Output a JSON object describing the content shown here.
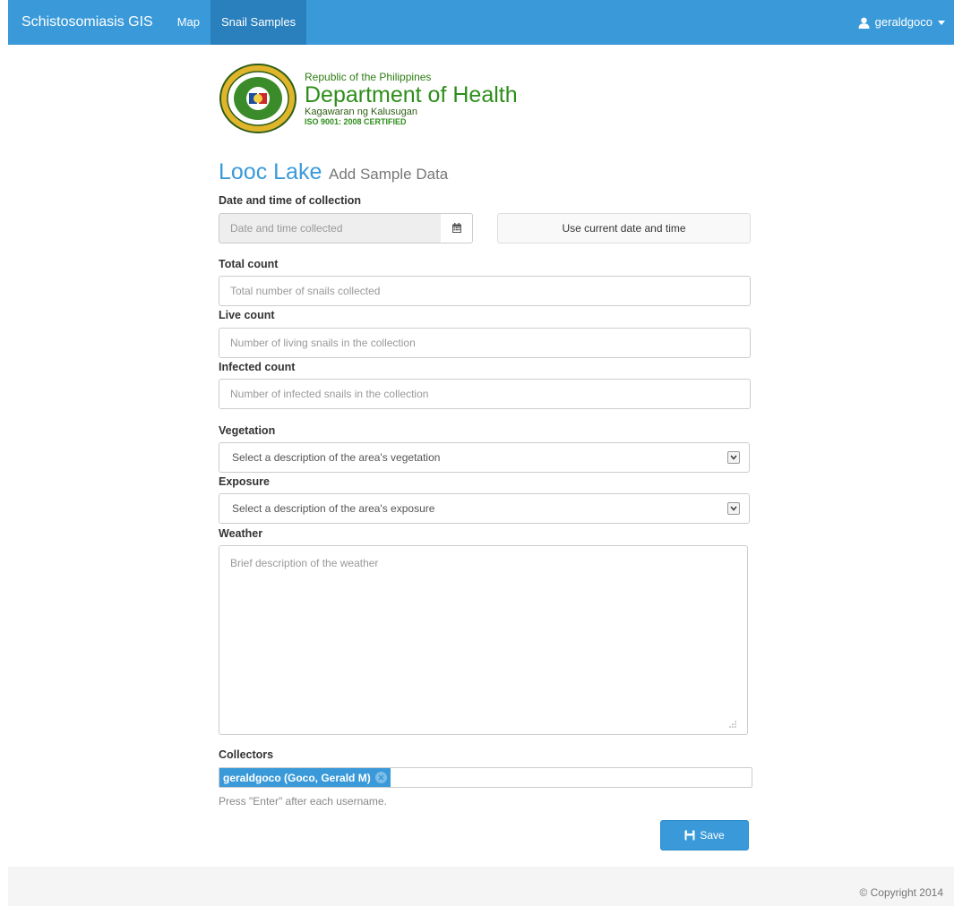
{
  "navbar": {
    "brand": "Schistosomiasis GIS",
    "links": [
      {
        "label": "Map",
        "active": false
      },
      {
        "label": "Snail Samples",
        "active": true
      }
    ],
    "user": "geraldgoco"
  },
  "header": {
    "line1": "Republic of the Philippines",
    "line2": "Department of Health",
    "line3": "Kagawaran ng Kalusugan",
    "line4": "ISO 9001: 2008 CERTIFIED"
  },
  "page": {
    "title": "Looc Lake",
    "subtitle": "Add Sample Data"
  },
  "form": {
    "date": {
      "label": "Date and time of collection",
      "placeholder": "Date and time collected",
      "icon": "calendar-icon",
      "now_button": "Use current date and time"
    },
    "total": {
      "label": "Total count",
      "placeholder": "Total number of snails collected"
    },
    "live": {
      "label": "Live count",
      "placeholder": "Number of living snails in the collection"
    },
    "infected": {
      "label": "Infected count",
      "placeholder": "Number of infected snails in the collection"
    },
    "vegetation": {
      "label": "Vegetation",
      "selected": "Select a description of the area's vegetation"
    },
    "exposure": {
      "label": "Exposure",
      "selected": "Select a description of the area's exposure"
    },
    "weather": {
      "label": "Weather",
      "placeholder": "Brief description of the weather"
    },
    "collectors": {
      "label": "Collectors",
      "tags": [
        "geraldgoco (Goco, Gerald M)"
      ],
      "help": "Press \"Enter\" after each username."
    },
    "save_label": "Save"
  },
  "footer": {
    "copyright": "© Copyright 2014"
  },
  "colors": {
    "primary": "#3a9ad9",
    "nav_active": "#2a80bd",
    "doh_green": "#2d8e1a"
  }
}
